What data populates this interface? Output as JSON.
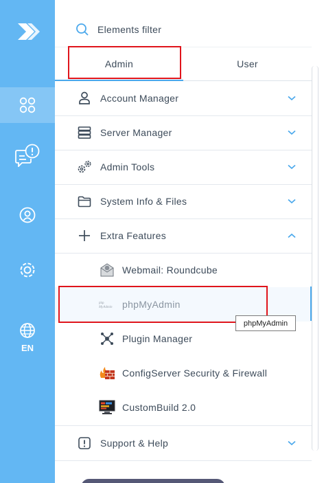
{
  "rail": {
    "items": [
      {
        "icon": "logo-arrows-icon"
      },
      {
        "icon": "apps-grid-icon",
        "active": true
      },
      {
        "icon": "message-alert-icon"
      },
      {
        "icon": "user-circle-icon"
      },
      {
        "icon": "gear-icon"
      },
      {
        "icon": "globe-icon",
        "label": "EN"
      }
    ]
  },
  "search": {
    "label": "Elements filter",
    "icon": "search-icon"
  },
  "tabs": [
    {
      "label": "Admin",
      "active": true
    },
    {
      "label": "User",
      "active": false
    }
  ],
  "menu": {
    "account_manager": "Account Manager",
    "server_manager": "Server Manager",
    "admin_tools": "Admin Tools",
    "system_info": "System Info & Files",
    "extra_features": "Extra Features",
    "support_help": "Support & Help"
  },
  "extra_features_items": {
    "webmail": "Webmail: Roundcube",
    "phpmyadmin": "phpMyAdmin",
    "plugin_manager": "Plugin Manager",
    "csf": "ConfigServer Security & Firewall",
    "custombuild": "CustomBuild 2.0"
  },
  "tooltip": "phpMyAdmin",
  "colors": {
    "rail": "#63b7f3",
    "accent": "#4aa8ec",
    "highlight_box": "#e0141b",
    "text": "#3d4b5a"
  }
}
